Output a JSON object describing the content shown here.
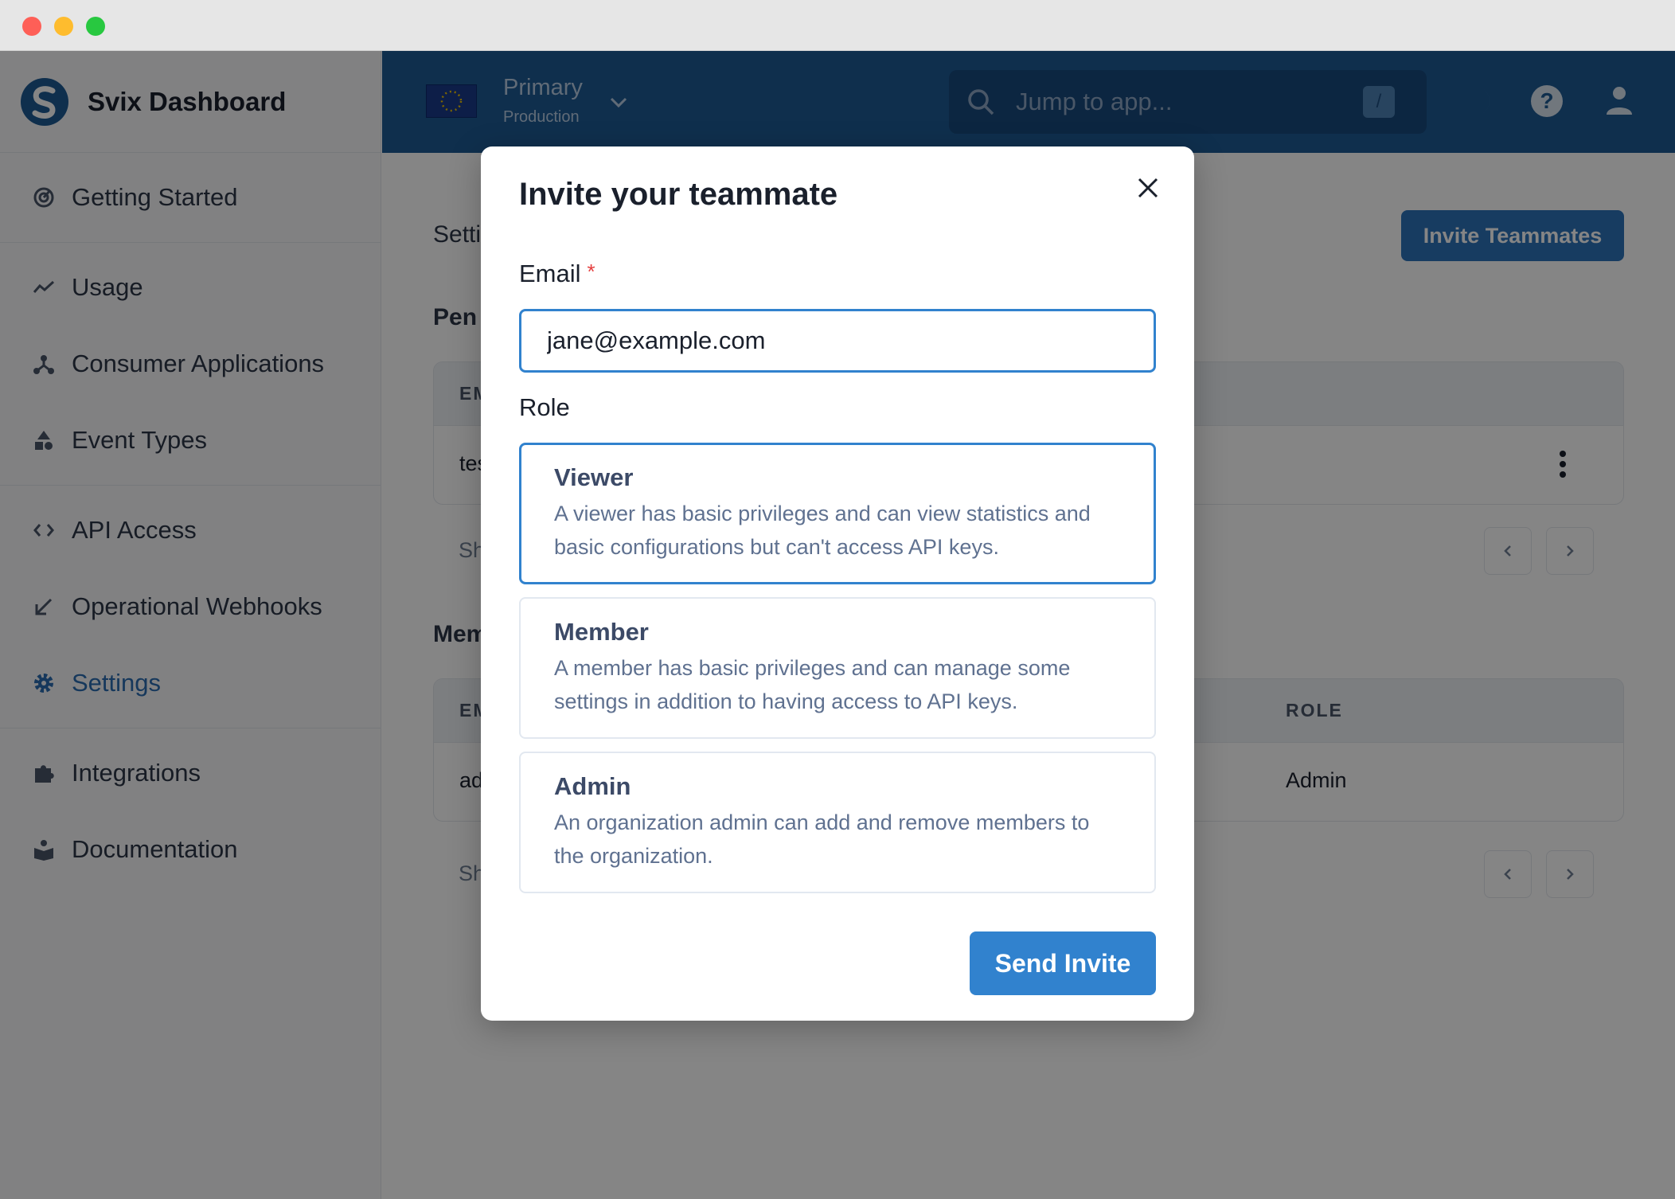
{
  "brand": {
    "name": "Svix Dashboard"
  },
  "sidebar": {
    "groups": [
      [
        {
          "label": "Getting Started",
          "icon": "getting-started-icon"
        }
      ],
      [
        {
          "label": "Usage",
          "icon": "usage-chart-icon"
        },
        {
          "label": "Consumer Applications",
          "icon": "applications-icon"
        },
        {
          "label": "Event Types",
          "icon": "event-types-icon"
        }
      ],
      [
        {
          "label": "API Access",
          "icon": "code-icon"
        },
        {
          "label": "Operational Webhooks",
          "icon": "arrow-down-left-icon"
        },
        {
          "label": "Settings",
          "icon": "gear-icon"
        }
      ],
      [
        {
          "label": "Integrations",
          "icon": "puzzle-icon"
        },
        {
          "label": "Documentation",
          "icon": "book-icon"
        }
      ]
    ],
    "active": "Settings"
  },
  "header": {
    "env_name": "Primary",
    "env_type": "Production",
    "search_placeholder": "Jump to app...",
    "search_shortcut": "/"
  },
  "main": {
    "title_fragment": "Setti",
    "invite_button": "Invite Teammates",
    "pending_heading_fragment": "Pen",
    "pending_table": {
      "col_email_fragment": "EM",
      "row_email_fragment": "tes"
    },
    "pending_footer_fragment": "Sh",
    "members_heading_fragment": "Mem",
    "members_table": {
      "col_email_fragment": "EM",
      "col_role": "ROLE",
      "row_email_fragment": "ad",
      "row_role": "Admin"
    },
    "members_footer_fragment": "Sh"
  },
  "modal": {
    "title": "Invite your teammate",
    "email_label": "Email",
    "required_mark": "*",
    "email_value": "jane@example.com",
    "role_label": "Role",
    "roles": [
      {
        "name": "Viewer",
        "description": "A viewer has basic privileges and can view statistics and basic configurations but can't access API keys.",
        "selected": true
      },
      {
        "name": "Member",
        "description": "A member has basic privileges and can manage some settings in addition to having access to API keys.",
        "selected": false
      },
      {
        "name": "Admin",
        "description": "An organization admin can add and remove members to the organization.",
        "selected": false
      }
    ],
    "submit_label": "Send Invite"
  },
  "colors": {
    "header_bg": "#1d5a95",
    "accent": "#3182ce",
    "active_nav": "#2b6cb0",
    "required": "#e53e3e"
  }
}
